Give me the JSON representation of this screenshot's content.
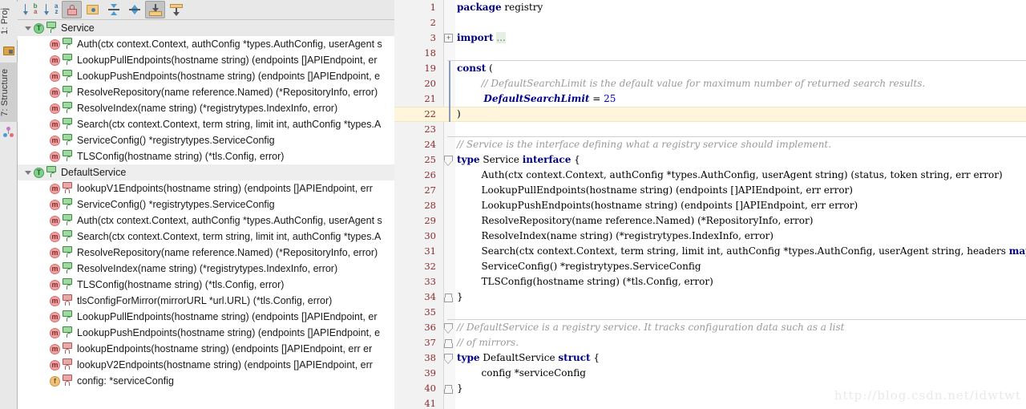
{
  "tool_strip": {
    "tabs": [
      {
        "name": "project",
        "label": "1: Proj",
        "icon": "project-folder-icon"
      },
      {
        "name": "structure",
        "label": "7: Structure",
        "icon": "structure-tree-icon"
      }
    ]
  },
  "structure_panel": {
    "toolbar": [
      {
        "name": "sort-by-visibility",
        "icon": "sort-visibility-icon",
        "pressed": false
      },
      {
        "name": "sort-alphabetically",
        "icon": "sort-alpha-icon",
        "pressed": false
      },
      {
        "name": "show-non-public",
        "icon": "lock-icon",
        "pressed": true
      },
      {
        "name": "group-by-package",
        "icon": "folder-dot-icon",
        "pressed": false
      },
      {
        "name": "expand-all",
        "icon": "expand-all-icon",
        "pressed": false
      },
      {
        "name": "collapse-all",
        "icon": "collapse-all-icon",
        "pressed": false
      },
      {
        "name": "show-imported",
        "icon": "import-into-icon",
        "pressed": true
      },
      {
        "name": "show-anonymous",
        "icon": "export-out-icon",
        "pressed": false
      }
    ],
    "tree": [
      {
        "kind": "type",
        "vis": "public",
        "label": "Service",
        "expanded": true,
        "selected": true
      },
      {
        "kind": "method",
        "vis": "public",
        "label": "Auth(ctx context.Context, authConfig *types.AuthConfig, userAgent s"
      },
      {
        "kind": "method",
        "vis": "public",
        "label": "LookupPullEndpoints(hostname string) (endpoints []APIEndpoint, er"
      },
      {
        "kind": "method",
        "vis": "public",
        "label": "LookupPushEndpoints(hostname string) (endpoints []APIEndpoint, e"
      },
      {
        "kind": "method",
        "vis": "public",
        "label": "ResolveRepository(name reference.Named) (*RepositoryInfo, error)"
      },
      {
        "kind": "method",
        "vis": "public",
        "label": "ResolveIndex(name string) (*registrytypes.IndexInfo, error)"
      },
      {
        "kind": "method",
        "vis": "public",
        "label": "Search(ctx context.Context, term string, limit int, authConfig *types.A"
      },
      {
        "kind": "method",
        "vis": "public",
        "label": "ServiceConfig() *registrytypes.ServiceConfig"
      },
      {
        "kind": "method",
        "vis": "public",
        "label": "TLSConfig(hostname string) (*tls.Config, error)"
      },
      {
        "kind": "type",
        "vis": "public",
        "label": "DefaultService",
        "expanded": true
      },
      {
        "kind": "method",
        "vis": "private",
        "label": "lookupV1Endpoints(hostname string) (endpoints []APIEndpoint, err"
      },
      {
        "kind": "method",
        "vis": "public",
        "label": "ServiceConfig() *registrytypes.ServiceConfig"
      },
      {
        "kind": "method",
        "vis": "public",
        "label": "Auth(ctx context.Context, authConfig *types.AuthConfig, userAgent s"
      },
      {
        "kind": "method",
        "vis": "public",
        "label": "Search(ctx context.Context, term string, limit int, authConfig *types.A"
      },
      {
        "kind": "method",
        "vis": "public",
        "label": "ResolveRepository(name reference.Named) (*RepositoryInfo, error)"
      },
      {
        "kind": "method",
        "vis": "public",
        "label": "ResolveIndex(name string) (*registrytypes.IndexInfo, error)"
      },
      {
        "kind": "method",
        "vis": "public",
        "label": "TLSConfig(hostname string) (*tls.Config, error)"
      },
      {
        "kind": "method",
        "vis": "private",
        "label": "tlsConfigForMirror(mirrorURL *url.URL) (*tls.Config, error)"
      },
      {
        "kind": "method",
        "vis": "public",
        "label": "LookupPullEndpoints(hostname string) (endpoints []APIEndpoint, er"
      },
      {
        "kind": "method",
        "vis": "public",
        "label": "LookupPushEndpoints(hostname string) (endpoints []APIEndpoint, e"
      },
      {
        "kind": "method",
        "vis": "private",
        "label": "lookupEndpoints(hostname string) (endpoints []APIEndpoint, err er"
      },
      {
        "kind": "method",
        "vis": "private",
        "label": "lookupV2Endpoints(hostname string) (endpoints []APIEndpoint, err"
      },
      {
        "kind": "field",
        "vis": "private",
        "label": "config: *serviceConfig"
      }
    ]
  },
  "editor": {
    "current_line": 22,
    "lines": [
      {
        "num": 1,
        "tokens": [
          {
            "t": "kw",
            "s": "package"
          },
          {
            "t": "plain",
            "s": " registry"
          }
        ]
      },
      {
        "num": 2,
        "tokens": []
      },
      {
        "num": 3,
        "tokens": [
          {
            "t": "kw",
            "s": "import"
          },
          {
            "t": "plain",
            "s": " "
          },
          {
            "t": "fold",
            "s": "..."
          }
        ],
        "fold": "plus"
      },
      {
        "num": 18,
        "tokens": [],
        "sep_below": true
      },
      {
        "num": 19,
        "tokens": [
          {
            "t": "kw",
            "s": "const"
          },
          {
            "t": "plain",
            "s": " ("
          }
        ]
      },
      {
        "num": 20,
        "tokens": [
          {
            "t": "cmt",
            "s": "        // DefaultSearchLimit is the default value for maximum number of returned search results."
          }
        ]
      },
      {
        "num": 21,
        "tokens": [
          {
            "t": "cst",
            "s": "        DefaultSearchLimit"
          },
          {
            "t": "plain",
            "s": " = "
          },
          {
            "t": "num",
            "s": "25"
          }
        ]
      },
      {
        "num": 22,
        "tokens": [
          {
            "t": "plain",
            "s": ")"
          }
        ]
      },
      {
        "num": 23,
        "tokens": [],
        "sep_below": true
      },
      {
        "num": 24,
        "tokens": [
          {
            "t": "cmt",
            "s": "// Service is the interface defining what a registry service should implement."
          }
        ]
      },
      {
        "num": 25,
        "tokens": [
          {
            "t": "kw",
            "s": "type"
          },
          {
            "t": "plain",
            "s": " Service "
          },
          {
            "t": "kw",
            "s": "interface"
          },
          {
            "t": "plain",
            "s": " {"
          }
        ],
        "fold": "open"
      },
      {
        "num": 26,
        "tokens": [
          {
            "t": "plain",
            "s": "        Auth(ctx context.Context, authConfig *types.AuthConfig, userAgent string) (status, token string, err error)"
          }
        ]
      },
      {
        "num": 27,
        "tokens": [
          {
            "t": "plain",
            "s": "        LookupPullEndpoints(hostname string) (endpoints []APIEndpoint, err error)"
          }
        ]
      },
      {
        "num": 28,
        "tokens": [
          {
            "t": "plain",
            "s": "        LookupPushEndpoints(hostname string) (endpoints []APIEndpoint, err error)"
          }
        ]
      },
      {
        "num": 29,
        "tokens": [
          {
            "t": "plain",
            "s": "        ResolveRepository(name reference.Named) (*RepositoryInfo, error)"
          }
        ]
      },
      {
        "num": 30,
        "tokens": [
          {
            "t": "plain",
            "s": "        ResolveIndex(name string) (*registrytypes.IndexInfo, error)"
          }
        ]
      },
      {
        "num": 31,
        "tokens": [
          {
            "t": "plain",
            "s": "        Search(ctx context.Context, term string, limit int, authConfig *types.AuthConfig, userAgent string, headers "
          },
          {
            "t": "kw",
            "s": "map"
          },
          {
            "t": "plain",
            "s": "["
          }
        ]
      },
      {
        "num": 32,
        "tokens": [
          {
            "t": "plain",
            "s": "        ServiceConfig() *registrytypes.ServiceConfig"
          }
        ]
      },
      {
        "num": 33,
        "tokens": [
          {
            "t": "plain",
            "s": "        TLSConfig(hostname string) (*tls.Config, error)"
          }
        ]
      },
      {
        "num": 34,
        "tokens": [
          {
            "t": "plain",
            "s": "}"
          }
        ],
        "fold": "end"
      },
      {
        "num": 35,
        "tokens": [],
        "sep_below": true
      },
      {
        "num": 36,
        "tokens": [
          {
            "t": "cmt",
            "s": "// DefaultService is a registry service. It tracks configuration data such as a list"
          }
        ],
        "fold": "open"
      },
      {
        "num": 37,
        "tokens": [
          {
            "t": "cmt",
            "s": "// of mirrors."
          }
        ],
        "fold": "end"
      },
      {
        "num": 38,
        "tokens": [
          {
            "t": "kw",
            "s": "type"
          },
          {
            "t": "plain",
            "s": " DefaultService "
          },
          {
            "t": "kw",
            "s": "struct"
          },
          {
            "t": "plain",
            "s": " {"
          }
        ],
        "fold": "open"
      },
      {
        "num": 39,
        "tokens": [
          {
            "t": "plain",
            "s": "        config *serviceConfig"
          }
        ]
      },
      {
        "num": 40,
        "tokens": [
          {
            "t": "plain",
            "s": "}"
          }
        ],
        "fold": "end"
      },
      {
        "num": 41,
        "tokens": []
      }
    ]
  },
  "watermark": {
    "text": "http://blog.csdn.net/idwtwt"
  },
  "colors": {
    "keyword": "#000080",
    "comment": "#9a9a9a",
    "constant": "#00008b",
    "number": "#0000d0",
    "line_number": "#8b2b2b",
    "current_line_bg": "#fdf6dd",
    "public_lock": "#3f8c44",
    "private_lock": "#b05757"
  }
}
